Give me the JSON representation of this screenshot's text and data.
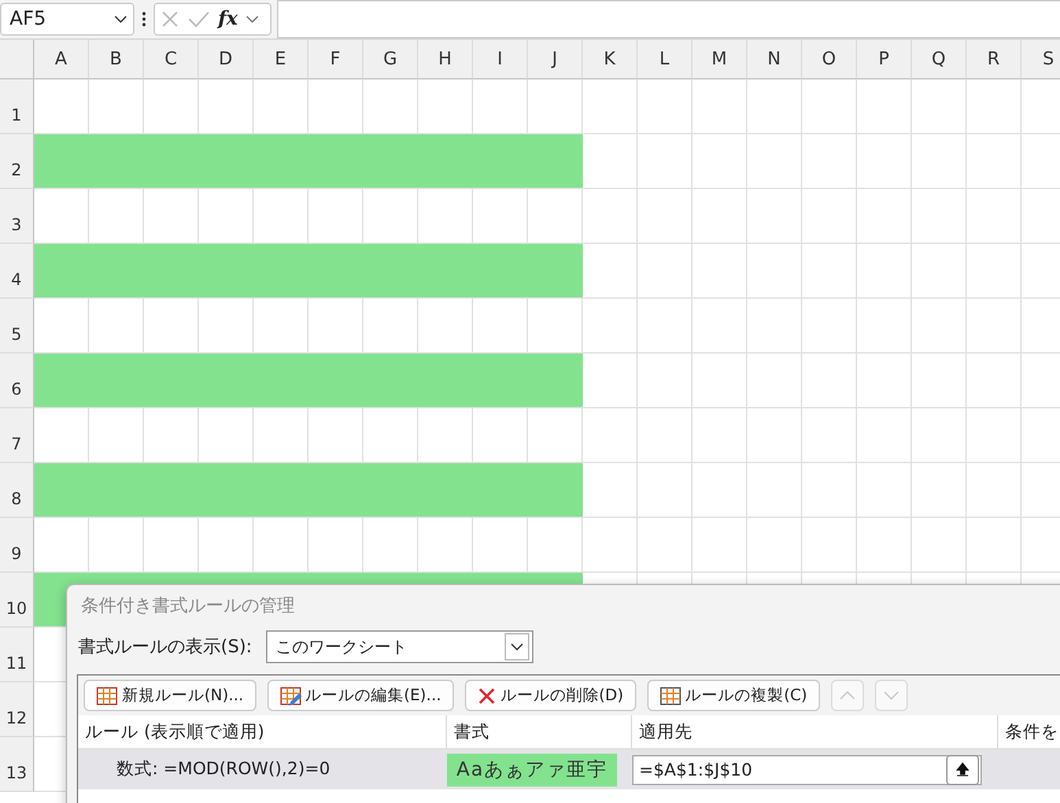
{
  "formula_bar": {
    "name_box": "AF5",
    "fx": "fx"
  },
  "columns": [
    "A",
    "B",
    "C",
    "D",
    "E",
    "F",
    "G",
    "H",
    "I",
    "J",
    "K",
    "L",
    "M",
    "N",
    "O",
    "P",
    "Q",
    "R",
    "S"
  ],
  "rows": [
    {
      "label": "1",
      "filled": false
    },
    {
      "label": "2",
      "filled": true
    },
    {
      "label": "3",
      "filled": false
    },
    {
      "label": "4",
      "filled": true
    },
    {
      "label": "5",
      "filled": false
    },
    {
      "label": "6",
      "filled": true
    },
    {
      "label": "7",
      "filled": false
    },
    {
      "label": "8",
      "filled": true
    },
    {
      "label": "9",
      "filled": false
    },
    {
      "label": "10",
      "filled": true
    },
    {
      "label": "11",
      "filled": false
    },
    {
      "label": "12",
      "filled": false
    },
    {
      "label": "13",
      "filled": false
    }
  ],
  "dialog": {
    "title": "条件付き書式ルールの管理",
    "show_label": "書式ルールの表示(S):",
    "show_value": "このワークシート",
    "buttons": [
      {
        "kind": "new",
        "label": "新規ルール(N)..."
      },
      {
        "kind": "edit",
        "label": "ルールの編集(E)..."
      },
      {
        "kind": "delete",
        "label": "ルールの削除(D)"
      },
      {
        "kind": "duplicate",
        "label": "ルールの複製(C)"
      }
    ],
    "move_up_disabled": true,
    "move_down_disabled": true,
    "table_columns": [
      "ルール (表示順で適用)",
      "書式",
      "適用先",
      "条件を"
    ],
    "rules": [
      {
        "rule": "数式: =MOD(ROW(),2)=0",
        "preview": "Aaあぁアァ亜宇",
        "applies_to": "=$A$1:$J$10",
        "selected": true
      }
    ]
  }
}
